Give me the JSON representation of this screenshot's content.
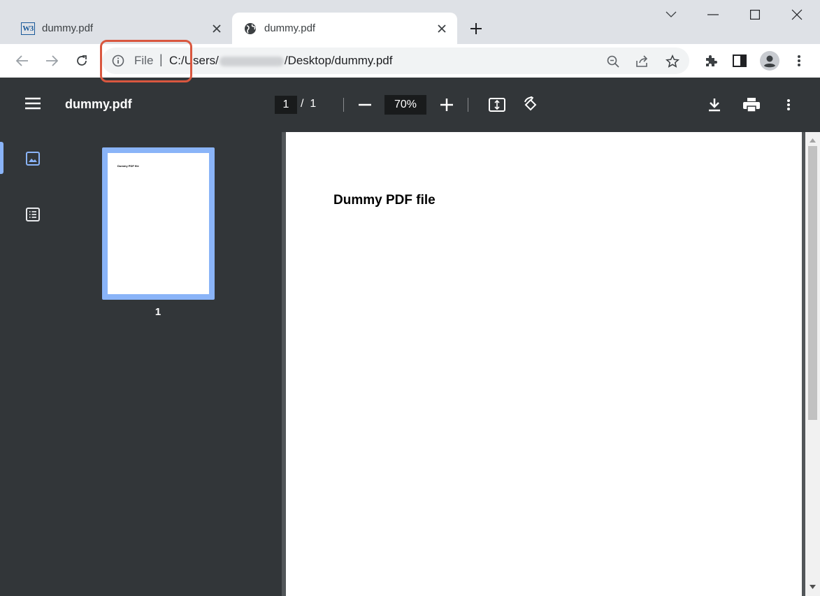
{
  "tabs": [
    {
      "title": "dummy.pdf",
      "favicon": "w3schools-icon",
      "favicon_text": "W3",
      "active": false
    },
    {
      "title": "dummy.pdf",
      "favicon": "globe-icon",
      "active": true
    }
  ],
  "address_bar": {
    "scheme_label": "File",
    "separator": "|",
    "url_prefix": "C:/Users/",
    "url_suffix": "/Desktop/dummy.pdf"
  },
  "pdf_toolbar": {
    "title": "dummy.pdf",
    "current_page": "1",
    "page_separator": "/",
    "total_pages": "1",
    "zoom": "70%"
  },
  "sidebar": {
    "thumbnail_label": "1",
    "thumbnail_text": "Dummy PDF file"
  },
  "document": {
    "heading": "Dummy PDF file"
  },
  "colors": {
    "highlight": "#d9573f",
    "pdf_toolbar_bg": "#323639",
    "thumbnail_accent": "#8ab4f8"
  }
}
